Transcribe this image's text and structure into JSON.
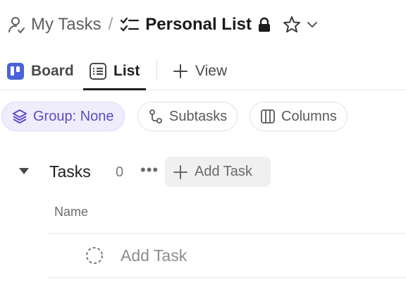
{
  "breadcrumb": {
    "space_label": "My Tasks",
    "separator": "/",
    "list_label": "Personal List",
    "icons": [
      "person-icon",
      "checklist-icon",
      "lock-icon",
      "star-icon",
      "chevron-down-icon"
    ]
  },
  "tabs": {
    "board_label": "Board",
    "list_label": "List",
    "add_view_label": "View",
    "active": "List"
  },
  "filters": {
    "group_label": "Group: None",
    "subtasks_label": "Subtasks",
    "columns_label": "Columns"
  },
  "task_group": {
    "title": "Tasks",
    "count": "0",
    "more_label": "•••",
    "add_task_label": "Add Task"
  },
  "table": {
    "column_name": "Name",
    "add_task_row_label": "Add Task"
  },
  "colors": {
    "accent": "#5b4cc4",
    "board_icon": "#4a62d8",
    "chip_active_bg": "#efedfc"
  }
}
